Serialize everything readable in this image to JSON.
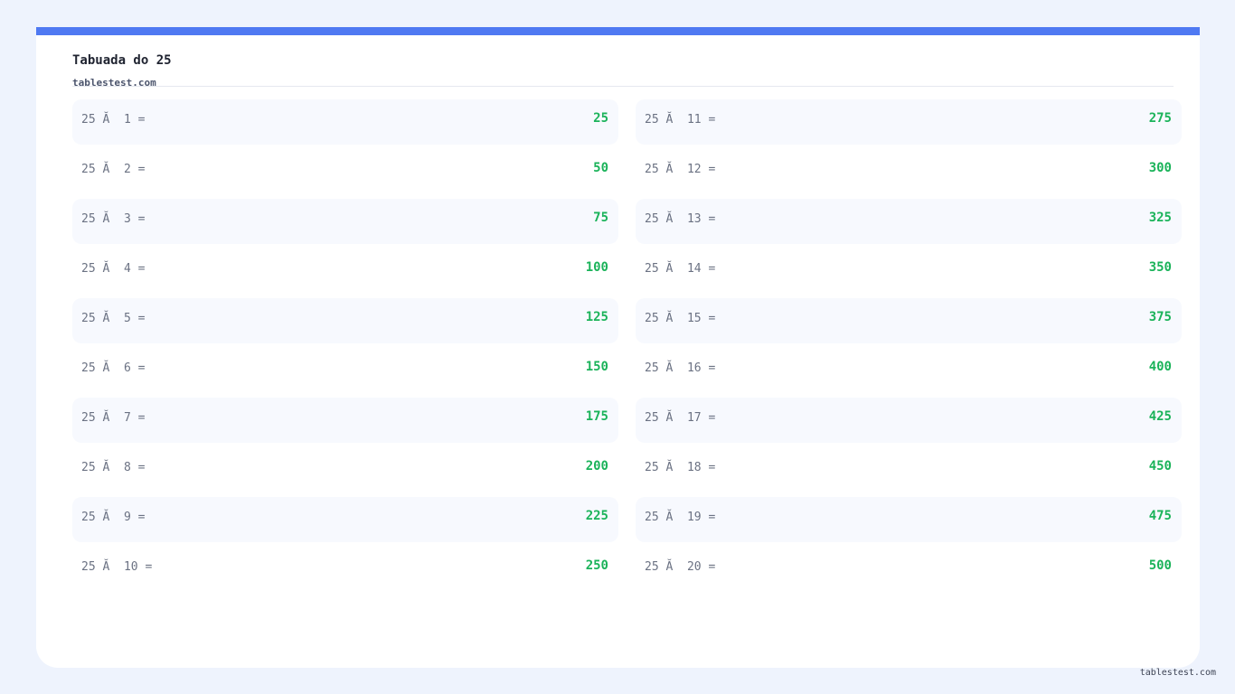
{
  "header": {
    "title": "Tabuada do 25",
    "site": "tablestest.com"
  },
  "colors": {
    "accent": "#4f79f2",
    "result": "#1bb35a",
    "background": "#eef3fd"
  },
  "table": {
    "left": [
      {
        "expr": "25 Ă  1 =",
        "result": "25"
      },
      {
        "expr": "25 Ă  2 =",
        "result": "50"
      },
      {
        "expr": "25 Ă  3 =",
        "result": "75"
      },
      {
        "expr": "25 Ă  4 =",
        "result": "100"
      },
      {
        "expr": "25 Ă  5 =",
        "result": "125"
      },
      {
        "expr": "25 Ă  6 =",
        "result": "150"
      },
      {
        "expr": "25 Ă  7 =",
        "result": "175"
      },
      {
        "expr": "25 Ă  8 =",
        "result": "200"
      },
      {
        "expr": "25 Ă  9 =",
        "result": "225"
      },
      {
        "expr": "25 Ă  10 =",
        "result": "250"
      }
    ],
    "right": [
      {
        "expr": "25 Ă  11 =",
        "result": "275"
      },
      {
        "expr": "25 Ă  12 =",
        "result": "300"
      },
      {
        "expr": "25 Ă  13 =",
        "result": "325"
      },
      {
        "expr": "25 Ă  14 =",
        "result": "350"
      },
      {
        "expr": "25 Ă  15 =",
        "result": "375"
      },
      {
        "expr": "25 Ă  16 =",
        "result": "400"
      },
      {
        "expr": "25 Ă  17 =",
        "result": "425"
      },
      {
        "expr": "25 Ă  18 =",
        "result": "450"
      },
      {
        "expr": "25 Ă  19 =",
        "result": "475"
      },
      {
        "expr": "25 Ă  20 =",
        "result": "500"
      }
    ]
  },
  "footer": {
    "site": "tablestest.com"
  }
}
